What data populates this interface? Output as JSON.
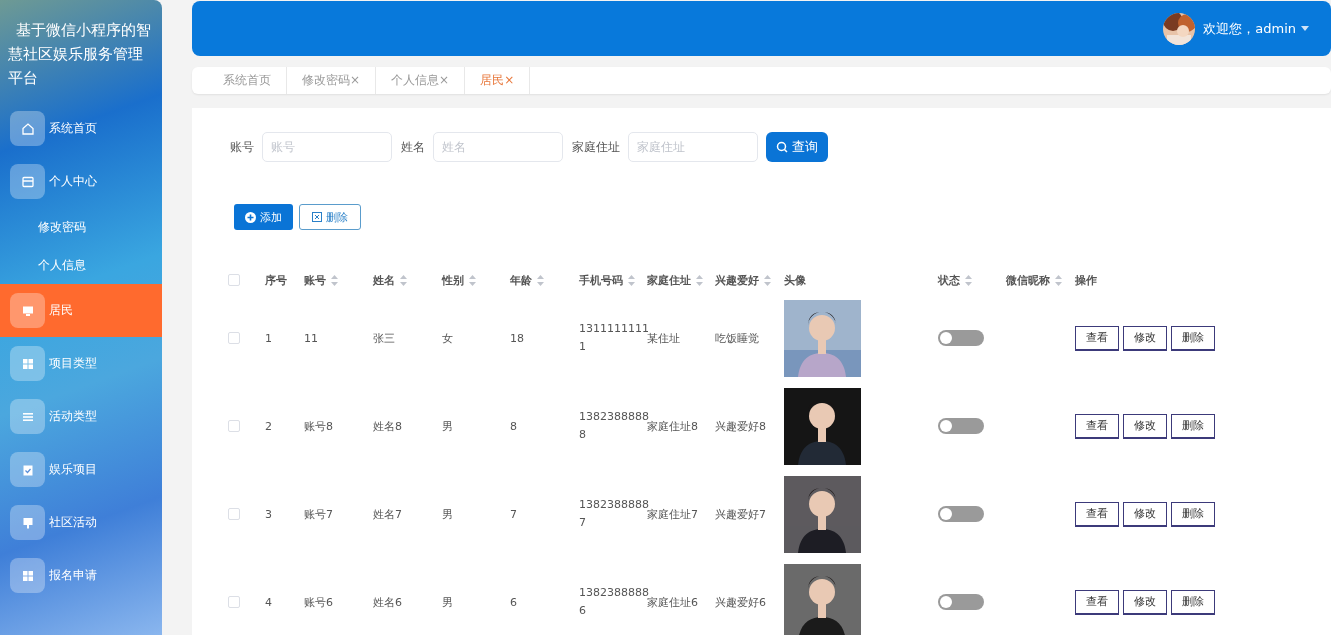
{
  "app_title": "基于微信小程序的智慧社区娱乐服务管理平台",
  "sidebar": {
    "items": [
      {
        "label": "系统首页",
        "kind": "home",
        "selected": false
      },
      {
        "label": "个人中心",
        "kind": "card",
        "selected": false,
        "children": [
          {
            "label": "修改密码",
            "selected": false
          },
          {
            "label": "个人信息",
            "selected": false
          }
        ]
      },
      {
        "label": "居民",
        "kind": "monitor",
        "selected": true
      },
      {
        "label": "项目类型",
        "kind": "grid",
        "selected": false
      },
      {
        "label": "活动类型",
        "kind": "list",
        "selected": false
      },
      {
        "label": "娱乐项目",
        "kind": "clipboard",
        "selected": false
      },
      {
        "label": "社区活动",
        "kind": "pin",
        "selected": false
      },
      {
        "label": "报名申请",
        "kind": "grid",
        "selected": false
      }
    ]
  },
  "header": {
    "greeting": "欢迎您，admin",
    "avatar": {
      "kind": "picture"
    }
  },
  "tabs": [
    {
      "label": "系统首页",
      "selected": false
    },
    {
      "label": "修改密码",
      "close": "×",
      "selected": false
    },
    {
      "label": "个人信息",
      "close": "×",
      "selected": false
    },
    {
      "label": "居民",
      "close": "×",
      "selected": true
    }
  ],
  "search": {
    "fields": [
      {
        "label": "账号",
        "placeholder": "账号"
      },
      {
        "label": "姓名",
        "placeholder": "姓名"
      },
      {
        "label": "家庭住址",
        "placeholder": "家庭住址"
      }
    ],
    "button": "查询"
  },
  "actions": {
    "add": "添加",
    "delete": "删除"
  },
  "table": {
    "select_all_checked": false,
    "columns": [
      {
        "label": "序号",
        "sortable": false
      },
      {
        "label": "账号",
        "sortable": true
      },
      {
        "label": "姓名",
        "sortable": true
      },
      {
        "label": "性别",
        "sortable": true
      },
      {
        "label": "年龄",
        "sortable": true
      },
      {
        "label": "手机号码",
        "sortable": true
      },
      {
        "label": "家庭住址",
        "sortable": true
      },
      {
        "label": "兴趣爱好",
        "sortable": true
      },
      {
        "label": "头像",
        "sortable": false
      },
      {
        "label": "状态",
        "sortable": true
      },
      {
        "label": "微信昵称",
        "sortable": true
      },
      {
        "label": "操作",
        "sortable": false
      }
    ],
    "rows": [
      {
        "checked": false,
        "index": "1",
        "account": "11",
        "name": "张三",
        "gender": "女",
        "age": "18",
        "phone": "13111111111",
        "address": "某住址",
        "hobby": "吃饭睡觉",
        "photo": {
          "kind": "picture"
        },
        "status_on": false,
        "buttons": [
          "查看",
          "修改",
          "删除"
        ]
      },
      {
        "checked": false,
        "index": "2",
        "account": "账号8",
        "name": "姓名8",
        "gender": "男",
        "age": "8",
        "phone": "13823888888",
        "address": "家庭住址8",
        "hobby": "兴趣爱好8",
        "photo": {
          "kind": "picture"
        },
        "status_on": false,
        "buttons": [
          "查看",
          "修改",
          "删除"
        ]
      },
      {
        "checked": false,
        "index": "3",
        "account": "账号7",
        "name": "姓名7",
        "gender": "男",
        "age": "7",
        "phone": "13823888887",
        "address": "家庭住址7",
        "hobby": "兴趣爱好7",
        "photo": {
          "kind": "picture"
        },
        "status_on": false,
        "buttons": [
          "查看",
          "修改",
          "删除"
        ]
      },
      {
        "checked": false,
        "index": "4",
        "account": "账号6",
        "name": "姓名6",
        "gender": "男",
        "age": "6",
        "phone": "13823888886",
        "address": "家庭住址6",
        "hobby": "兴趣爱好6",
        "photo": {
          "kind": "picture"
        },
        "status_on": false,
        "buttons": [
          "查看",
          "修改",
          "删除"
        ]
      }
    ]
  }
}
